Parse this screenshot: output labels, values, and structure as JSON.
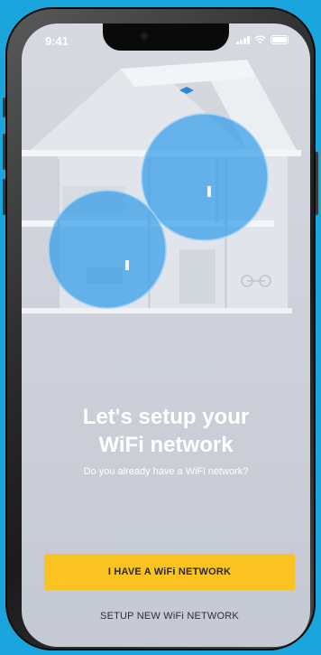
{
  "status_bar": {
    "time": "9:41"
  },
  "onboarding": {
    "title_line1": "Let's setup your",
    "title_line2": "WiFi network",
    "subtitle": "Do you already have a WiFi network?"
  },
  "actions": {
    "primary_label": "I HAVE A WiFi NETWORK",
    "secondary_label": "SETUP NEW WiFi NETWORK"
  },
  "colors": {
    "background": "#1aa6dc",
    "accent": "#fbc321",
    "coverage": "#2f9bea"
  },
  "icons": [
    "signal-icon",
    "wifi-icon",
    "battery-icon"
  ]
}
